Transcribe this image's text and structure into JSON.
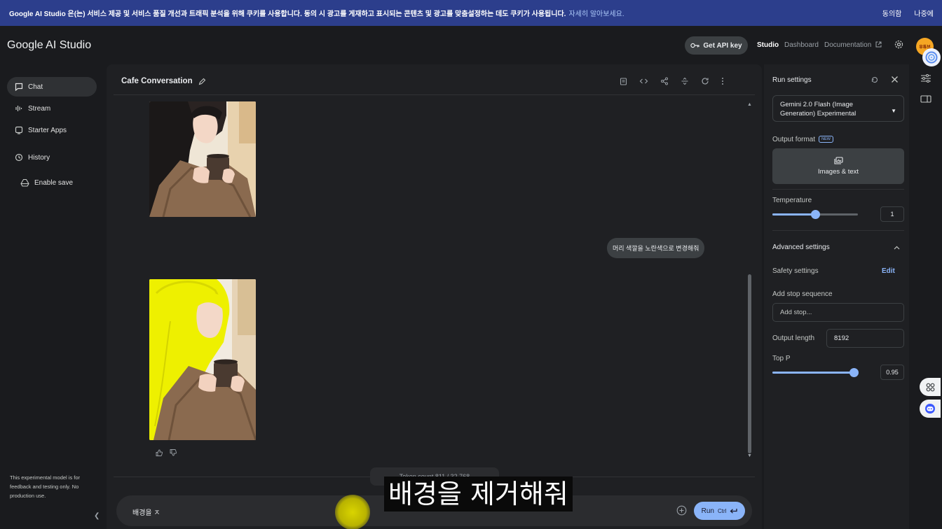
{
  "banner": {
    "text": "Google AI Studio 은(는) 서비스 제공 및 서비스 품질 개선과 트래픽 분석을 위해 쿠키를 사용합니다. 동의 시 광고를 게재하고 표시되는 콘텐츠 및 광고를 맞춤설정하는 데도 쿠키가 사용됩니다.",
    "link": "자세히 알아보세요.",
    "agree": "동의함",
    "later": "나중에"
  },
  "header": {
    "logo": "Google AI Studio",
    "api_key": "Get API key",
    "nav": {
      "studio": "Studio",
      "dashboard": "Dashboard",
      "documentation": "Documentation"
    },
    "avatar_text": "유튜브"
  },
  "sidebar": {
    "items": [
      {
        "label": "Chat",
        "icon": "chat-icon"
      },
      {
        "label": "Stream",
        "icon": "stream-icon"
      },
      {
        "label": "Starter Apps",
        "icon": "apps-icon"
      },
      {
        "label": "History",
        "icon": "history-icon"
      },
      {
        "label": "Enable save",
        "icon": "drive-icon"
      }
    ],
    "note": "This experimental model is for feedback and testing only. No production use."
  },
  "main": {
    "title": "Cafe Conversation",
    "user_message": "머리 색깔을 노란색으로 변경해줘",
    "token_count": "Token count 811 / 32,768",
    "prompt_value": "배경을 ㅈ",
    "run_label": "Run",
    "run_shortcut": "Ctrl",
    "subtitle": "배경을 제거해줘"
  },
  "run_settings": {
    "title": "Run settings",
    "model": "Gemini 2.0 Flash (Image Generation) Experimental",
    "output_format_label": "Output format",
    "new_badge": "NEW",
    "output_format_value": "Images & text",
    "temperature_label": "Temperature",
    "temperature_value": "1",
    "temperature_fraction": 0.5,
    "advanced_label": "Advanced settings",
    "safety_label": "Safety settings",
    "safety_edit": "Edit",
    "stop_label": "Add stop sequence",
    "stop_placeholder": "Add stop...",
    "output_length_label": "Output length",
    "output_length_value": "8192",
    "top_p_label": "Top P",
    "top_p_value": "0.95",
    "top_p_fraction": 0.95
  },
  "colors": {
    "accent": "#8ab4f8",
    "banner": "#2c3e8c",
    "background": "#1a1b1e",
    "panel": "#1f2023"
  }
}
